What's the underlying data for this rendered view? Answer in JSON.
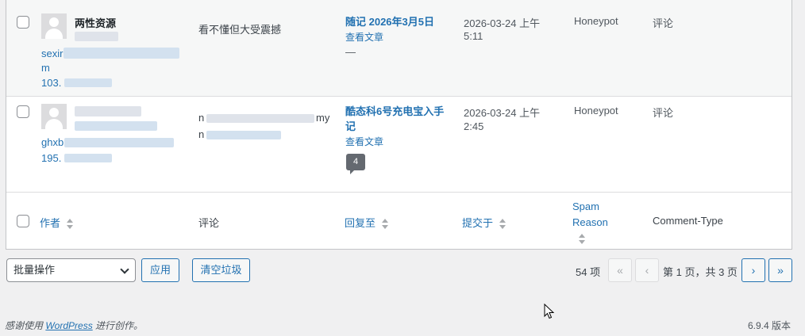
{
  "rows": [
    {
      "author_name": "两性资源",
      "author_url_prefix": "sexir",
      "author_url_wrap": "m",
      "author_ip_prefix": "103.",
      "comment": "看不懂但大受震撼",
      "post_title": "随记 2026年3月5日",
      "view_post": "查看文章",
      "pending": "—",
      "date_line1": "2026-03-24 上午",
      "date_line2": "5:11",
      "spam_reason": "Honeypot",
      "comment_type": "评论"
    },
    {
      "author_url_prefix": "ghxb",
      "author_ip_prefix": "195.",
      "comment_prefix": "n",
      "comment_suffix": "my",
      "comment_line2_prefix": "n",
      "post_title_line1": "酷态科6号充电宝入手",
      "post_title_line2": "记",
      "view_post": "查看文章",
      "comment_count": "4",
      "date_line1": "2026-03-24 上午",
      "date_line2": "2:45",
      "spam_reason": "Honeypot",
      "comment_type": "评论"
    }
  ],
  "footer_headers": {
    "author": "作者",
    "comment": "评论",
    "in_response_to": "回复至",
    "submitted_on": "提交于",
    "spam_reason_line1": "Spam",
    "spam_reason_line2": "Reason",
    "comment_type": "Comment-Type"
  },
  "bulk_actions": {
    "selected": "批量操作",
    "apply": "应用",
    "empty_spam": "清空垃圾"
  },
  "pagination": {
    "total_items": "54 项",
    "first": "«",
    "prev": "‹",
    "page_info": "第 1 页，共 3 页",
    "next": "›",
    "last": "»"
  },
  "footer": {
    "thanks_prefix": "感谢使用",
    "wordpress": "WordPress",
    "thanks_suffix": "进行创作。",
    "version": "6.9.4 版本"
  }
}
